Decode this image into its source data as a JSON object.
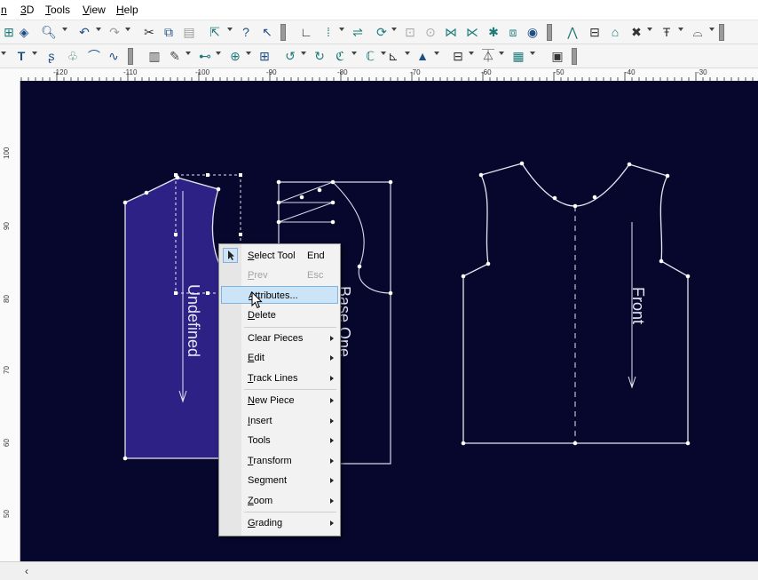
{
  "menubar": {
    "items": [
      {
        "prefix": "",
        "ul": "n",
        "rest": ""
      },
      {
        "prefix": "",
        "ul": "3",
        "rest": "D"
      },
      {
        "prefix": "",
        "ul": "T",
        "rest": "ools"
      },
      {
        "prefix": "",
        "ul": "V",
        "rest": "iew"
      },
      {
        "prefix": "",
        "ul": "H",
        "rest": "elp"
      }
    ]
  },
  "rulers": {
    "horizontal": [
      "-120",
      "-110",
      "-100",
      "-90",
      "-80",
      "-70",
      "-60",
      "-50",
      "-40",
      "-30"
    ],
    "vertical": [
      "100",
      "90",
      "80",
      "70",
      "60",
      "50"
    ]
  },
  "pieces": {
    "undefined_label": "Undefined",
    "base_label": "Base One",
    "front_label": "Front"
  },
  "context_menu": {
    "items": [
      {
        "ul": "S",
        "rest": "elect Tool",
        "shortcut": "End",
        "enabled": true
      },
      {
        "ul": "P",
        "rest": "rev",
        "shortcut": "Esc",
        "enabled": false
      },
      {
        "ul": "A",
        "rest": "ttributes...",
        "shortcut": "",
        "enabled": true
      },
      {
        "ul": "D",
        "rest": "elete",
        "shortcut": "",
        "enabled": true
      },
      {
        "ul": "",
        "rest": "Clear Pieces",
        "shortcut": "",
        "enabled": true
      },
      {
        "ul": "E",
        "rest": "dit",
        "shortcut": "",
        "enabled": true
      },
      {
        "ul": "T",
        "rest": "rack Lines",
        "shortcut": "",
        "enabled": true
      },
      {
        "ul": "N",
        "rest": "ew Piece",
        "shortcut": "",
        "enabled": true
      },
      {
        "ul": "I",
        "rest": "nsert",
        "shortcut": "",
        "enabled": true
      },
      {
        "ul": "",
        "rest": "Tools",
        "shortcut": "",
        "enabled": true
      },
      {
        "ul": "T",
        "rest": "ransform",
        "shortcut": "",
        "enabled": true
      },
      {
        "ul": "",
        "rest": "Segment",
        "shortcut": "",
        "enabled": true
      },
      {
        "ul": "Z",
        "rest": "oom",
        "shortcut": "",
        "enabled": true
      },
      {
        "ul": "G",
        "rest": "rading",
        "shortcut": "",
        "enabled": true
      }
    ]
  },
  "colors": {
    "canvas_bg": "#07072d",
    "piece_fill": "#2e2185",
    "outline": "#e6e6f2",
    "menu_highlight": "#cce4f7"
  }
}
